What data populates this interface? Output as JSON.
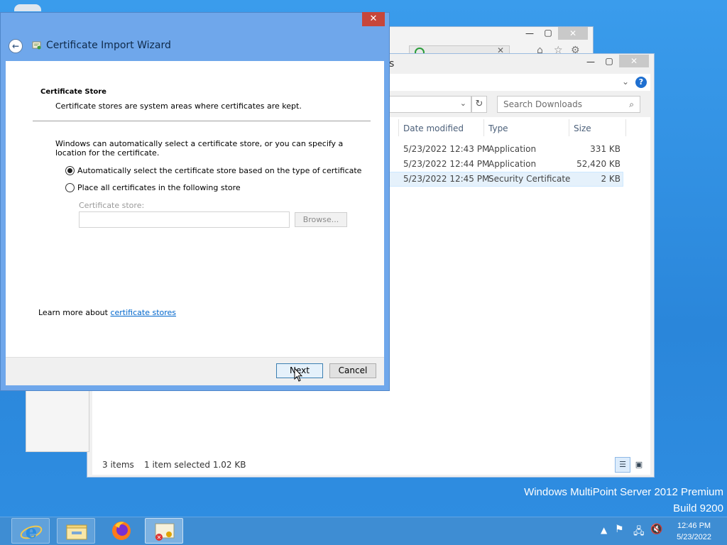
{
  "wizard": {
    "title": "Certificate Import Wizard",
    "close_glyph": "✕",
    "back_glyph": "←",
    "section_title": "Certificate Store",
    "section_description": "Certificate stores are system areas where certificates are kept.",
    "paragraph": "Windows can automatically select a certificate store, or you can specify a location for the certificate.",
    "radio_auto_label": "Automatically select the certificate store based on the type of certificate",
    "radio_place_label": "Place all certificates in the following store",
    "radio_selected": "auto",
    "store_label": "Certificate store:",
    "store_value": "",
    "browse_label": "Browse...",
    "learn_more_prefix": "Learn more about ",
    "learn_more_link": "certificate stores",
    "next_label": "Next",
    "cancel_label": "Cancel"
  },
  "explorer": {
    "title_fragment": "s",
    "search_placeholder": "Search Downloads",
    "columns": [
      "Date modified",
      "Type",
      "Size"
    ],
    "rows": [
      {
        "date": "5/23/2022 12:43 PM",
        "type": "Application",
        "size": "331 KB",
        "selected": false
      },
      {
        "date": "5/23/2022 12:44 PM",
        "type": "Application",
        "size": "52,420 KB",
        "selected": false
      },
      {
        "date": "5/23/2022 12:45 PM",
        "type": "Security Certificate",
        "size": "2 KB",
        "selected": true
      }
    ],
    "status_items": "3 items",
    "status_selected": "1 item selected  1.02 KB"
  },
  "ie": {
    "tab_title": ""
  },
  "desktop": {
    "brand_line1": "Windows MultiPoint Server 2012 Premium",
    "brand_line2": "Build 9200"
  },
  "taskbar": {
    "apps": [
      "internet-explorer",
      "file-explorer",
      "firefox",
      "certificate-wizard"
    ],
    "clock_time": "12:46 PM",
    "clock_date": "5/23/2022"
  },
  "colors": {
    "desktop": "#2f8fe0",
    "wizard_frame": "#6fa7eb",
    "close_red": "#c7463a",
    "link": "#0066cc"
  }
}
